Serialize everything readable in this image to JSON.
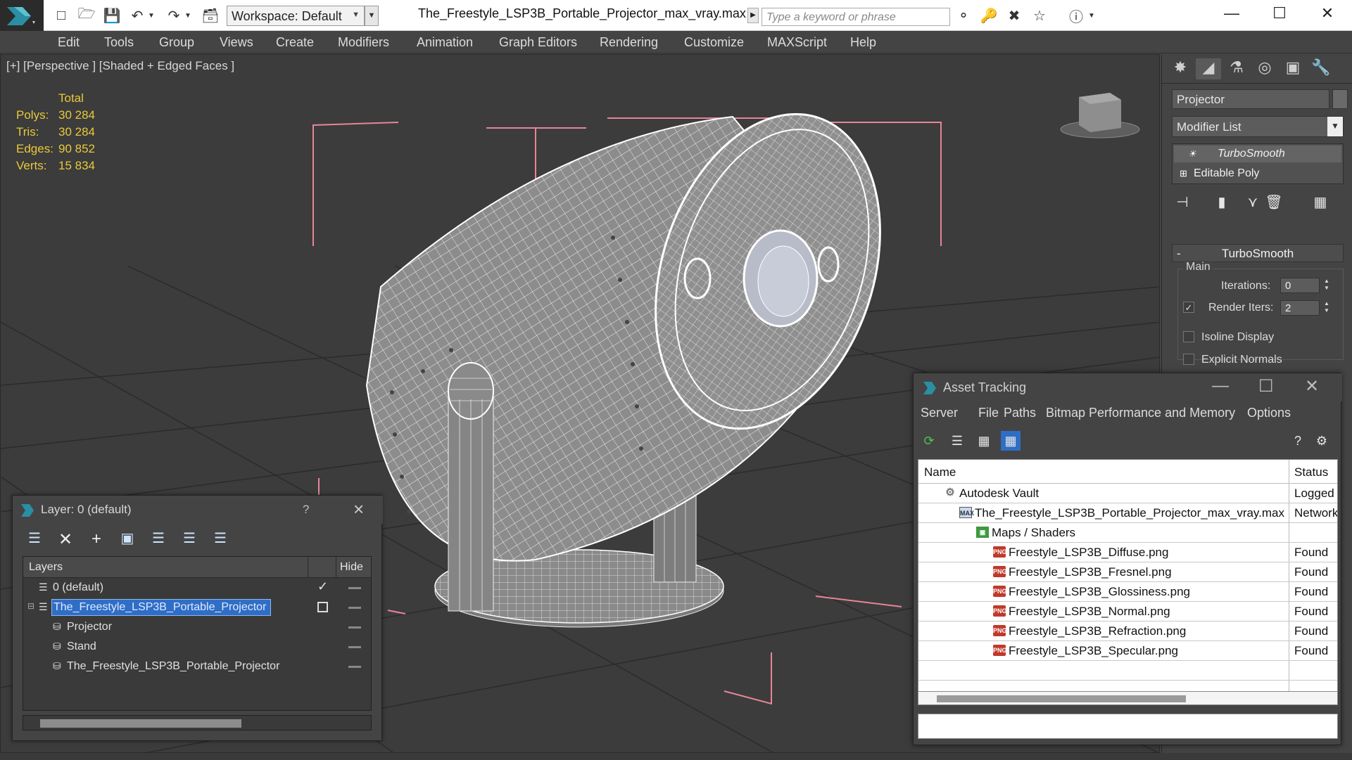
{
  "window": {
    "title": "The_Freestyle_LSP3B_Portable_Projector_max_vray.max",
    "workspace_label": "Workspace: Default",
    "search_placeholder": "Type a keyword or phrase"
  },
  "menu": {
    "items": [
      "Edit",
      "Tools",
      "Group",
      "Views",
      "Create",
      "Modifiers",
      "Animation",
      "Graph Editors",
      "Rendering",
      "Customize",
      "MAXScript",
      "Help"
    ]
  },
  "viewport": {
    "label": "[+] [Perspective ] [Shaded + Edged Faces ]",
    "stats": {
      "header": "Total",
      "rows": [
        {
          "key": "Polys:",
          "value": "30 284"
        },
        {
          "key": "Tris:",
          "value": "30 284"
        },
        {
          "key": "Edges:",
          "value": "90 852"
        },
        {
          "key": "Verts:",
          "value": "15 834"
        }
      ]
    }
  },
  "command_panel": {
    "object_name": "Projector",
    "modifier_list": "Modifier List",
    "stack": [
      "TurboSmooth",
      "Editable Poly"
    ],
    "rollout_title": "TurboSmooth",
    "group_label": "Main",
    "iterations_label": "Iterations:",
    "iterations_value": "0",
    "render_iters_label": "Render Iters:",
    "render_iters_value": "2",
    "isoline_label": "Isoline Display",
    "explicit_normals_label": "Explicit Normals"
  },
  "layer_explorer": {
    "title": "Layer: 0 (default)",
    "help": "?",
    "col_layers": "Layers",
    "col_hide": "Hide",
    "rows": [
      {
        "name": "0 (default)"
      },
      {
        "name": "The_Freestyle_LSP3B_Portable_Projector"
      },
      {
        "name": "Projector"
      },
      {
        "name": "Stand"
      },
      {
        "name": "The_Freestyle_LSP3B_Portable_Projector"
      }
    ]
  },
  "asset_tracking": {
    "title": "Asset Tracking",
    "menu": [
      "Server",
      "File",
      "Paths",
      "Bitmap Performance and Memory",
      "Options"
    ],
    "col_name": "Name",
    "col_status": "Status",
    "rows": [
      {
        "name": "Autodesk Vault",
        "status": "Logged",
        "icon": "vault-icon"
      },
      {
        "name": "The_Freestyle_LSP3B_Portable_Projector_max_vray.max",
        "status": "Network",
        "icon": "max-file-icon"
      },
      {
        "name": "Maps / Shaders",
        "status": "",
        "icon": "maps-icon"
      },
      {
        "name": "Freestyle_LSP3B_Diffuse.png",
        "status": "Found",
        "icon": "png-icon"
      },
      {
        "name": "Freestyle_LSP3B_Fresnel.png",
        "status": "Found",
        "icon": "png-icon"
      },
      {
        "name": "Freestyle_LSP3B_Glossiness.png",
        "status": "Found",
        "icon": "png-icon"
      },
      {
        "name": "Freestyle_LSP3B_Normal.png",
        "status": "Found",
        "icon": "png-icon"
      },
      {
        "name": "Freestyle_LSP3B_Refraction.png",
        "status": "Found",
        "icon": "png-icon"
      },
      {
        "name": "Freestyle_LSP3B_Specular.png",
        "status": "Found",
        "icon": "png-icon"
      }
    ]
  },
  "colors": {
    "stats_text": "#e8c93a",
    "selection_blue": "#2f6ec6",
    "bounding_box_pink": "#e8849b",
    "grid_dark": "#2a2a2a"
  }
}
